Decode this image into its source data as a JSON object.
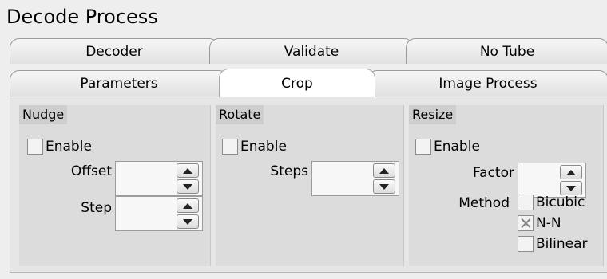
{
  "window": {
    "title": "Decode Process"
  },
  "tabs_row1": [
    {
      "label": "Decoder"
    },
    {
      "label": "Validate"
    },
    {
      "label": "No Tube"
    }
  ],
  "tabs_row2": [
    {
      "label": "Parameters"
    },
    {
      "label": "Crop",
      "active": true
    },
    {
      "label": "Image Process"
    }
  ],
  "nudge": {
    "title": "Nudge",
    "enable_label": "Enable",
    "enable_checked": false,
    "offset_label": "Offset",
    "offset_value": "",
    "step_label": "Step",
    "step_value": ""
  },
  "rotate": {
    "title": "Rotate",
    "enable_label": "Enable",
    "enable_checked": false,
    "steps_label": "Steps",
    "steps_value": ""
  },
  "resize": {
    "title": "Resize",
    "enable_label": "Enable",
    "enable_checked": false,
    "factor_label": "Factor",
    "factor_value": "",
    "method_label": "Method",
    "methods": [
      {
        "label": "Bicubic",
        "checked": false
      },
      {
        "label": "N-N",
        "checked": true
      },
      {
        "label": "Bilinear",
        "checked": false
      }
    ]
  },
  "colors": {
    "background": "#eeeeee",
    "group_bg": "#dcdcdc",
    "active_tab": "#ffffff"
  },
  "icons": {
    "spin_up": "triangle-up-icon",
    "spin_down": "triangle-down-icon"
  }
}
